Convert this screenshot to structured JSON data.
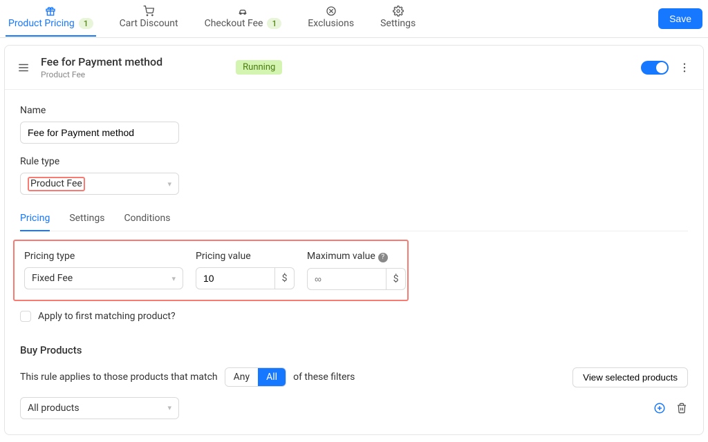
{
  "topbar": {
    "tabs": [
      {
        "label": "Product Pricing",
        "badge": "1"
      },
      {
        "label": "Cart Discount"
      },
      {
        "label": "Checkout Fee",
        "badge": "1"
      },
      {
        "label": "Exclusions"
      },
      {
        "label": "Settings"
      }
    ],
    "save_label": "Save"
  },
  "header": {
    "title": "Fee for Payment method",
    "subtitle": "Product Fee",
    "status": "Running"
  },
  "form": {
    "name_label": "Name",
    "name_value": "Fee for Payment method",
    "ruletype_label": "Rule type",
    "ruletype_value": "Product Fee"
  },
  "subtabs": {
    "pricing": "Pricing",
    "settings": "Settings",
    "conditions": "Conditions"
  },
  "pricing": {
    "type_label": "Pricing type",
    "type_value": "Fixed Fee",
    "value_label": "Pricing value",
    "value_value": "10",
    "value_unit": "$",
    "max_label": "Maximum value",
    "max_placeholder": "∞",
    "max_unit": "$",
    "apply_first": "Apply to first matching product?"
  },
  "buy": {
    "title": "Buy Products",
    "match_prefix": "This rule applies to those products that match",
    "any": "Any",
    "all": "All",
    "match_suffix": "of these filters",
    "view_btn": "View selected products",
    "filter_value": "All products"
  }
}
